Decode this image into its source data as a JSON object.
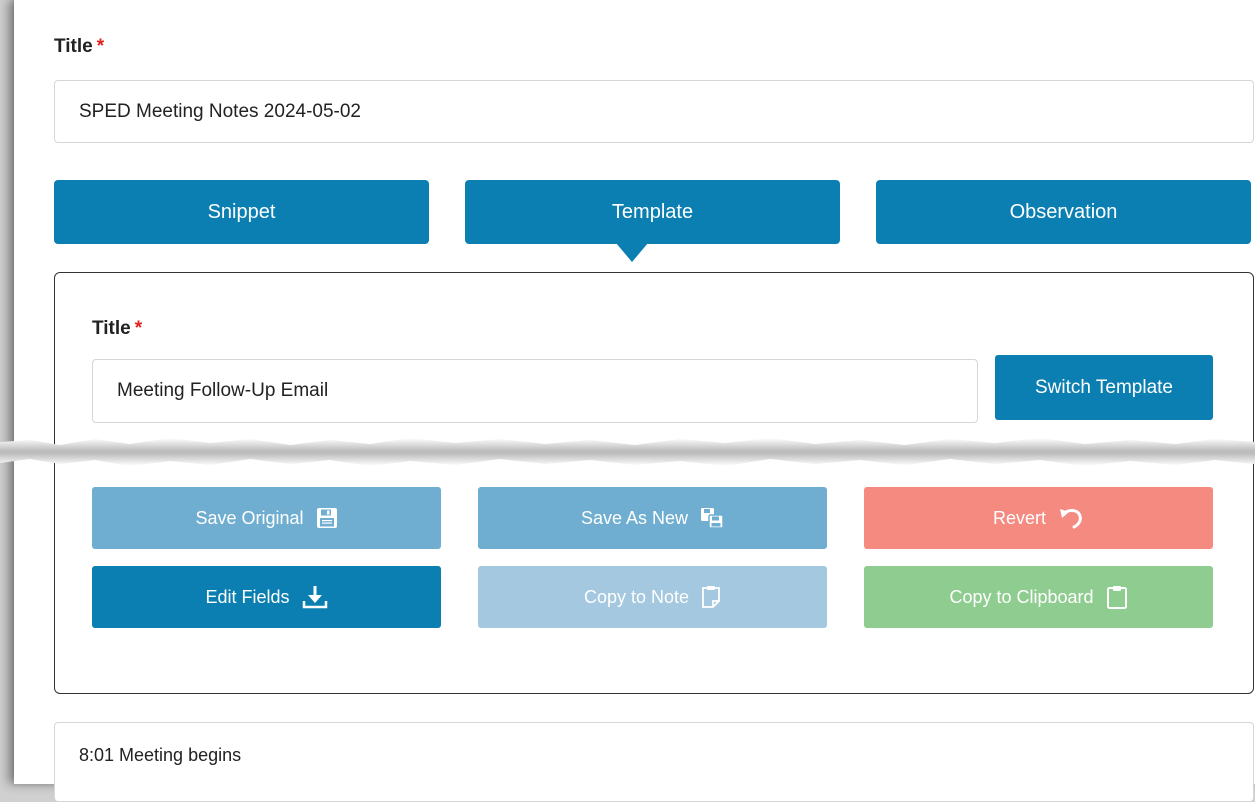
{
  "note": {
    "title_label": "Title",
    "required_mark": "*",
    "title_value": "SPED Meeting Notes 2024-05-02"
  },
  "tabs": [
    {
      "label": "Snippet"
    },
    {
      "label": "Template"
    },
    {
      "label": "Observation"
    }
  ],
  "template_panel": {
    "title_label": "Title",
    "required_mark": "*",
    "title_value": "Meeting Follow-Up Email",
    "switch_button": "Switch Template",
    "buttons": {
      "save_original": "Save Original",
      "save_as_new": "Save As New",
      "revert": "Revert",
      "edit_fields": "Edit Fields",
      "copy_to_note": "Copy to Note",
      "copy_to_clipboard": "Copy to Clipboard"
    },
    "icons": {
      "save_original": "floppy-disk-icon",
      "save_as_new": "copy-save-icon",
      "revert": "undo-icon",
      "edit_fields": "download-icon",
      "copy_to_note": "note-file-icon",
      "copy_to_clipboard": "clipboard-icon"
    }
  },
  "body_text": "8:01 Meeting begins",
  "colors": {
    "primary": "#0b7fb2",
    "primary_light": "#6faed0",
    "primary_disabled": "#a3c8df",
    "danger": "#f48a80",
    "success": "#8fcc8f",
    "required": "#e02020"
  }
}
